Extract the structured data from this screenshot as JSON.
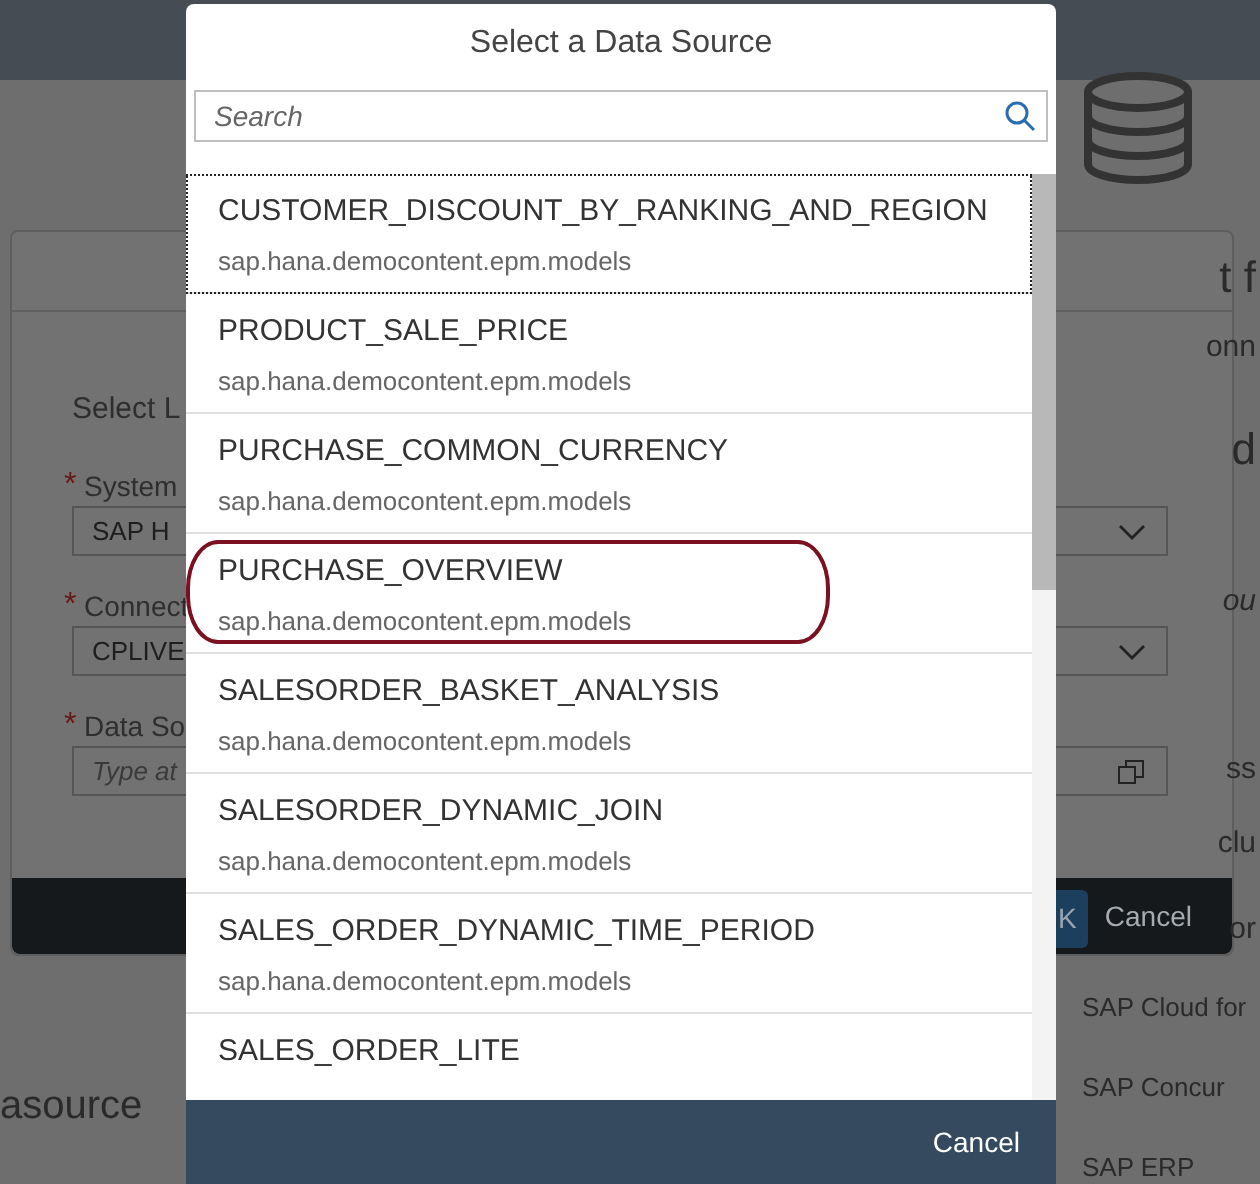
{
  "background": {
    "fragments_left": [
      "asource"
    ],
    "fragments_right": [
      "t f",
      "onn",
      "d",
      "ou",
      "ss",
      "clu",
      "or"
    ],
    "sources": [
      "SAP Cloud for",
      "SAP Concur",
      "SAP ERP"
    ]
  },
  "middle_dialog": {
    "title": "Select L",
    "fields": [
      {
        "marker": "*",
        "label": "System",
        "kind": "select",
        "value": "SAP H"
      },
      {
        "marker": "*",
        "label": "Connect",
        "kind": "select",
        "value": "CPLIVE"
      },
      {
        "marker": "*",
        "label": "Data So",
        "kind": "valuehelp",
        "placeholder": "Type at"
      }
    ],
    "buttons": [
      "K",
      "Cancel"
    ]
  },
  "dialog": {
    "title": "Select a Data Source",
    "search": {
      "placeholder": "Search"
    },
    "items": [
      {
        "name": "CUSTOMER_DISCOUNT_BY_RANKING_AND_REGION",
        "package": "sap.hana.democontent.epm.models",
        "focused": true,
        "highlighted": false
      },
      {
        "name": "PRODUCT_SALE_PRICE",
        "package": "sap.hana.democontent.epm.models",
        "focused": false,
        "highlighted": false
      },
      {
        "name": "PURCHASE_COMMON_CURRENCY",
        "package": "sap.hana.democontent.epm.models",
        "focused": false,
        "highlighted": false
      },
      {
        "name": "PURCHASE_OVERVIEW",
        "package": "sap.hana.democontent.epm.models",
        "focused": false,
        "highlighted": true
      },
      {
        "name": "SALESORDER_BASKET_ANALYSIS",
        "package": "sap.hana.democontent.epm.models",
        "focused": false,
        "highlighted": false
      },
      {
        "name": "SALESORDER_DYNAMIC_JOIN",
        "package": "sap.hana.democontent.epm.models",
        "focused": false,
        "highlighted": false
      },
      {
        "name": "SALES_ORDER_DYNAMIC_TIME_PERIOD",
        "package": "sap.hana.democontent.epm.models",
        "focused": false,
        "highlighted": false
      },
      {
        "name": "SALES_ORDER_LITE",
        "focused": false,
        "highlighted": false
      }
    ],
    "buttons": [
      "Cancel"
    ]
  }
}
